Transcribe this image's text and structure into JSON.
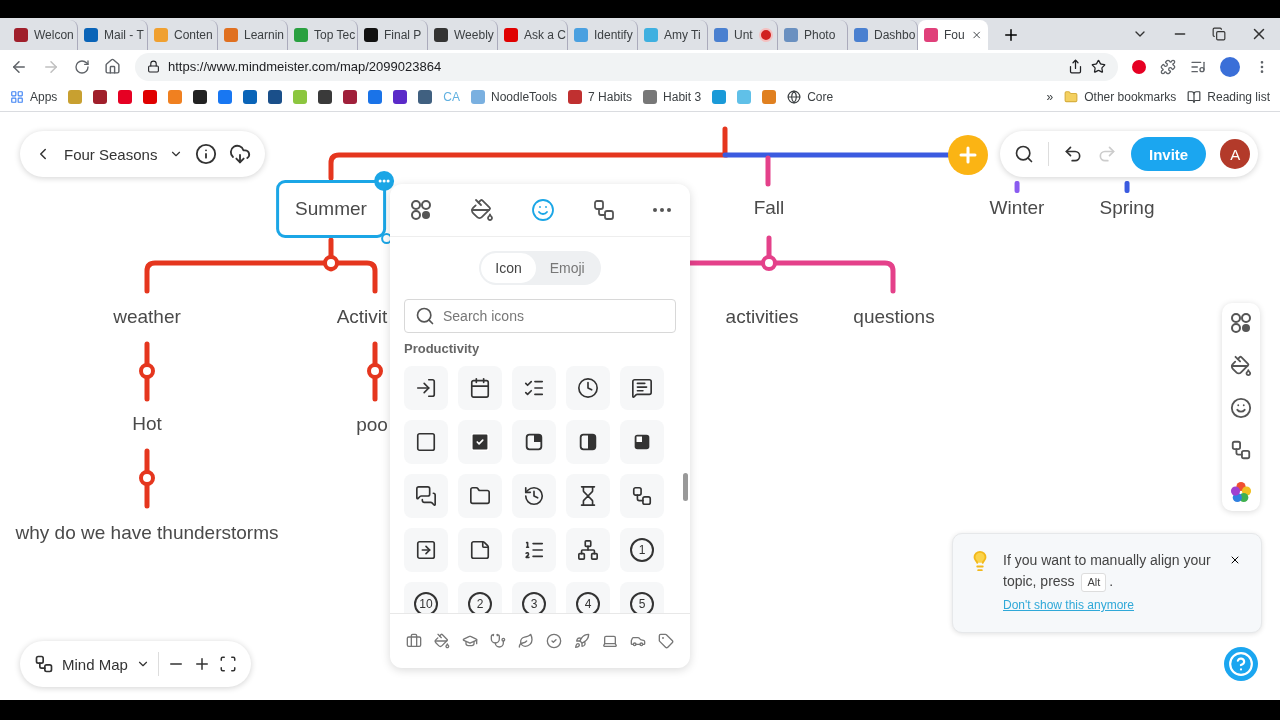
{
  "browser": {
    "tabs": [
      {
        "title": "Welcon",
        "color": "#a01f2b",
        "selected": false,
        "recording": false
      },
      {
        "title": "Mail - T",
        "color": "#0a64b8",
        "selected": false,
        "recording": false
      },
      {
        "title": "Conten",
        "color": "#f0a030",
        "selected": false,
        "recording": false
      },
      {
        "title": "Learnin",
        "color": "#e07020",
        "selected": false,
        "recording": false
      },
      {
        "title": "Top Tec",
        "color": "#2aa040",
        "selected": false,
        "recording": false
      },
      {
        "title": "Final P",
        "color": "#111111",
        "selected": false,
        "recording": false
      },
      {
        "title": "Weebly",
        "color": "#333333",
        "selected": false,
        "recording": false
      },
      {
        "title": "Ask a C",
        "color": "#e00000",
        "selected": false,
        "recording": false
      },
      {
        "title": "Identify",
        "color": "#4aa0e0",
        "selected": false,
        "recording": false
      },
      {
        "title": "Amy Ti",
        "color": "#3fb0e0",
        "selected": false,
        "recording": false
      },
      {
        "title": "Unt",
        "color": "#4a80d0",
        "selected": false,
        "recording": true
      },
      {
        "title": "Photo",
        "color": "#6a90c0",
        "selected": false,
        "recording": false
      },
      {
        "title": "Dashbo",
        "color": "#4a80d0",
        "selected": false,
        "recording": false
      },
      {
        "title": "Fou",
        "color": "#e0407a",
        "selected": true,
        "recording": false
      }
    ],
    "url": "https://www.mindmeister.com/map/2099023864",
    "forward_disabled": true,
    "bookmarks": [
      {
        "kind": "apps",
        "label": "Apps"
      },
      {
        "kind": "icon",
        "color": "#c8a030"
      },
      {
        "kind": "icon",
        "color": "#a01f2b"
      },
      {
        "kind": "icon",
        "color": "#e60023"
      },
      {
        "kind": "icon",
        "color": "#e00000"
      },
      {
        "kind": "icon",
        "color": "#f08020"
      },
      {
        "kind": "icon",
        "color": "#222222"
      },
      {
        "kind": "icon",
        "color": "#1877f2"
      },
      {
        "kind": "icon",
        "color": "#0a64b8"
      },
      {
        "kind": "icon",
        "color": "#1a4f8a"
      },
      {
        "kind": "icon",
        "color": "#8cc63f"
      },
      {
        "kind": "icon",
        "color": "#3a3a3a"
      },
      {
        "kind": "icon",
        "color": "#a0203a"
      },
      {
        "kind": "icon",
        "color": "#1a73e8"
      },
      {
        "kind": "icon",
        "color": "#5b2ac8"
      },
      {
        "kind": "icon",
        "color": "#406080"
      },
      {
        "kind": "text",
        "label": "CA",
        "color": "#60b0e0"
      },
      {
        "kind": "icon",
        "color": "#7ab0e0",
        "label": "NoodleTools"
      },
      {
        "kind": "icon",
        "color": "#c03030",
        "label": "7 Habits"
      },
      {
        "kind": "icon",
        "color": "#777777",
        "label": "Habit 3"
      },
      {
        "kind": "icon",
        "color": "#1a9ad8"
      },
      {
        "kind": "icon",
        "color": "#60c0e8"
      },
      {
        "kind": "icon",
        "color": "#e08020"
      },
      {
        "kind": "globe",
        "label": "Core"
      }
    ],
    "overflow": "»",
    "other_bookmarks": "Other bookmarks",
    "reading_list": "Reading list"
  },
  "map": {
    "title": "Four Seasons",
    "invite": "Invite",
    "avatar": "A",
    "undo_disabled": false,
    "redo_disabled": true,
    "topics": [
      {
        "label": "Summer",
        "color": "#e5361e",
        "selected": true,
        "children": [
          {
            "label": "weather",
            "children": [
              {
                "label": "Hot",
                "children": [
                  {
                    "label": "why do we have thunderstorms"
                  }
                ]
              }
            ]
          },
          {
            "label": "Activit",
            "children": [
              {
                "label": "poo"
              }
            ]
          }
        ]
      },
      {
        "label": "Fall",
        "color": "#e4418a",
        "selected": false,
        "children": [
          {
            "label": "activities"
          },
          {
            "label": "questions"
          }
        ]
      },
      {
        "label": "Winter",
        "color": "#8a5cf0",
        "selected": false
      },
      {
        "label": "Spring",
        "color": "#3b5be0",
        "selected": false
      }
    ],
    "view_mode": "Mind Map"
  },
  "icon_panel": {
    "tabs": [
      {
        "kind": "style",
        "selected": false
      },
      {
        "kind": "paint",
        "selected": false
      },
      {
        "kind": "icon",
        "selected": true
      },
      {
        "kind": "layout",
        "selected": false
      },
      {
        "kind": "more",
        "selected": false
      }
    ],
    "modes": [
      {
        "label": "Icon",
        "selected": true
      },
      {
        "label": "Emoji",
        "selected": false
      }
    ],
    "search": {
      "placeholder": "Search icons"
    },
    "section": "Productivity",
    "icons": [
      {
        "kind": "login"
      },
      {
        "kind": "calendar"
      },
      {
        "kind": "checklist"
      },
      {
        "kind": "clock"
      },
      {
        "kind": "comment"
      },
      {
        "kind": "box"
      },
      {
        "kind": "box-checked"
      },
      {
        "kind": "quarter"
      },
      {
        "kind": "half"
      },
      {
        "kind": "three-quarter"
      },
      {
        "kind": "comments"
      },
      {
        "kind": "folder"
      },
      {
        "kind": "history"
      },
      {
        "kind": "hourglass"
      },
      {
        "kind": "network"
      },
      {
        "kind": "import"
      },
      {
        "kind": "note"
      },
      {
        "kind": "numbered-list"
      },
      {
        "kind": "hierarchy"
      },
      {
        "kind": "number",
        "label": "1"
      },
      {
        "kind": "number",
        "label": "10"
      },
      {
        "kind": "number",
        "label": "2"
      },
      {
        "kind": "number",
        "label": "3"
      },
      {
        "kind": "number",
        "label": "4"
      },
      {
        "kind": "number",
        "label": "5"
      }
    ]
  },
  "hint": {
    "text": "If you want to manually align your topic, press",
    "key": "Alt",
    "after": ".",
    "link": "Don't show this anymore"
  }
}
